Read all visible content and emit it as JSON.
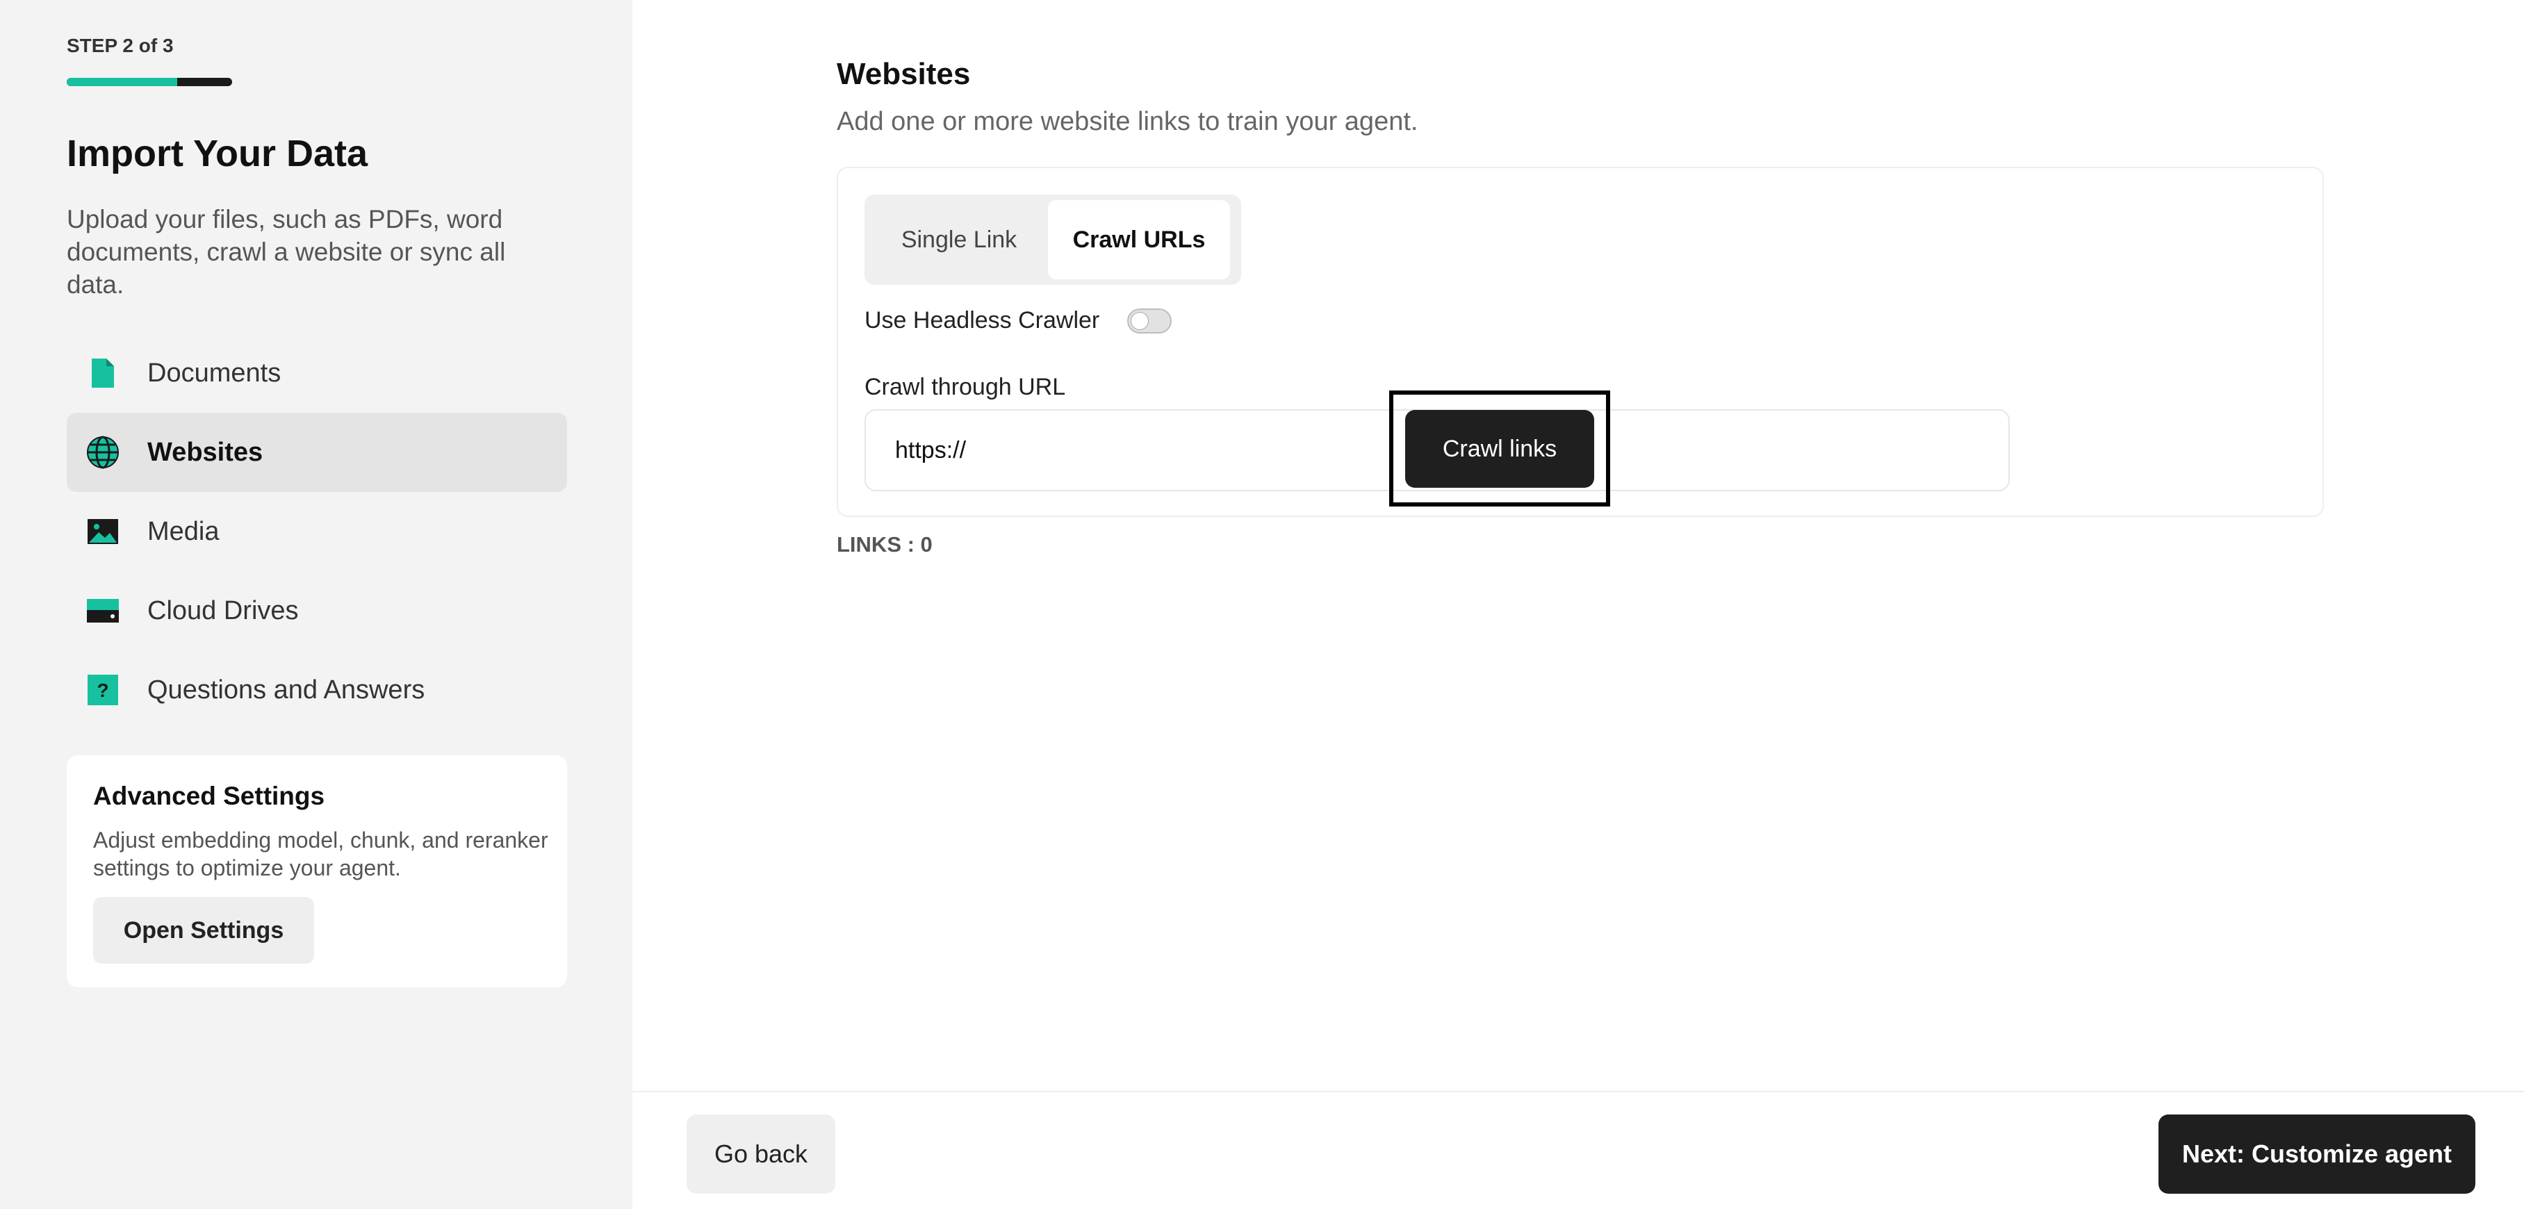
{
  "sidebar": {
    "step_label": "STEP 2 of 3",
    "progress_percent": 66.7,
    "title": "Import Your Data",
    "description": "Upload your files, such as PDFs, word documents, crawl a website or sync all data.",
    "items": [
      {
        "label": "Documents",
        "icon": "document-icon",
        "active": false
      },
      {
        "label": "Websites",
        "icon": "globe-icon",
        "active": true
      },
      {
        "label": "Media",
        "icon": "image-icon",
        "active": false
      },
      {
        "label": "Cloud Drives",
        "icon": "drive-icon",
        "active": false
      },
      {
        "label": "Questions and Answers",
        "icon": "question-icon",
        "active": false
      }
    ],
    "advanced": {
      "title": "Advanced Settings",
      "description": "Adjust embedding model, chunk, and reranker settings to optimize your agent.",
      "button_label": "Open Settings"
    }
  },
  "main": {
    "title": "Websites",
    "subtitle": "Add one or more website links to train your agent.",
    "tabs": [
      {
        "label": "Single Link",
        "active": false
      },
      {
        "label": "Crawl URLs",
        "active": true
      }
    ],
    "headless_label": "Use Headless Crawler",
    "headless_enabled": false,
    "url_label": "Crawl through URL",
    "url_value": "https://",
    "crawl_button": "Crawl links",
    "links_count": "LINKS : 0"
  },
  "footer": {
    "back_label": "Go back",
    "next_label": "Next: Customize agent"
  },
  "colors": {
    "accent": "#17c1a0",
    "dark_button": "#1f1f1f",
    "sidebar_bg": "#f3f3f3"
  }
}
